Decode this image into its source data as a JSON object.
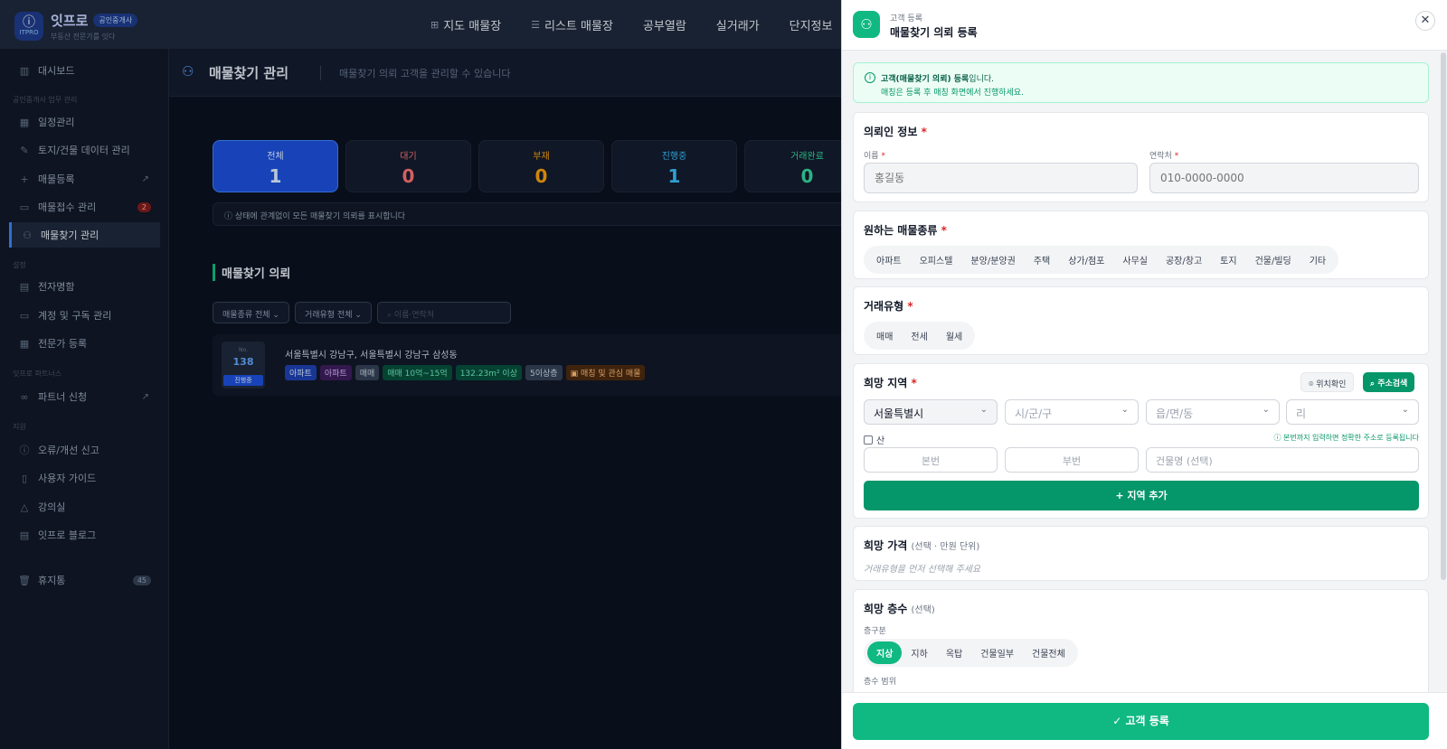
{
  "app": {
    "logo_glyph": "ⓘ",
    "logo_mark": "ITPRO",
    "name": "잇프로",
    "badge": "공인중개사",
    "tagline": "부동산 전문가를 잇다"
  },
  "topnav": {
    "items": [
      {
        "label": "지도 매물장",
        "icon": "map-icon"
      },
      {
        "label": "리스트 매물장",
        "icon": "list-icon"
      },
      {
        "label": "공부열람"
      },
      {
        "label": "실거래가"
      },
      {
        "label": "단지정보"
      }
    ]
  },
  "sidebar": {
    "dashboard": "대시보드",
    "section_work": "공인중개사 업무 관리",
    "schedule": "일정관리",
    "land_data": "토지/건물 데이터 관리",
    "listing_register": "매물등록",
    "listing_intake": "매물접수 관리",
    "listing_intake_count": "2",
    "property_search": "매물찾기 관리",
    "section_settings": "설정",
    "business_card": "전자명함",
    "account": "계정 및 구독 관리",
    "expert_register": "전문가 등록",
    "section_partners": "잇프로 파트너스",
    "partner_apply": "파트너 신청",
    "section_support": "지원",
    "report": "오류/개선 신고",
    "guide": "사용자 가이드",
    "lecture": "강의실",
    "blog": "잇프로 블로그",
    "trash": "휴지통",
    "trash_count": "45"
  },
  "page": {
    "title": "매물찾기 관리",
    "description": "매물찾기 의뢰 고객을 관리할 수 있습니다",
    "stats": [
      {
        "label": "전체",
        "value": "1",
        "color": "#dbeafe"
      },
      {
        "label": "대기",
        "value": "0",
        "color": "#f87171"
      },
      {
        "label": "부재",
        "value": "0",
        "color": "#f59e0b"
      },
      {
        "label": "진행중",
        "value": "1",
        "color": "#38bdf8"
      },
      {
        "label": "거래완료",
        "value": "0",
        "color": "#34d399"
      }
    ],
    "stat_note": "상태에 관계없이 모든 매물찾기 의뢰를 표시합니다",
    "list_title": "매물찾기 의뢰",
    "filter_type": "매물종류 전체",
    "filter_deal": "거래유형 전체",
    "search_placeholder": "이름·연락처",
    "card": {
      "prefix": "No.",
      "number": "138",
      "status": "진행중",
      "address": "서울특별시 강남구, 서울특별시 강남구 삼성동",
      "tags": [
        {
          "text": "아파트",
          "style": "t-blue"
        },
        {
          "text": "아파트",
          "style": "t-purple"
        },
        {
          "text": "매매",
          "style": "t-gray"
        },
        {
          "text": "매매 10억~15억",
          "style": "t-green"
        },
        {
          "text": "132.23m² 이상",
          "style": "t-green"
        },
        {
          "text": "5이상층",
          "style": "t-gray"
        },
        {
          "text": "매칭 및 관심 매물",
          "style": "t-orange"
        }
      ]
    }
  },
  "drawer": {
    "crumb": "고객 등록",
    "title": "매물찾기 의뢰 등록",
    "notice_bold": "고객(매물찾기 의뢰) 등록",
    "notice_rest": "입니다.",
    "notice_line2": "매칭은 등록 후 매칭 화면에서 진행하세요.",
    "requester": {
      "title": "의뢰인 정보",
      "name_label": "이름",
      "name_placeholder": "홍길동",
      "phone_label": "연락처",
      "phone_placeholder": "010-0000-0000"
    },
    "property_types": {
      "title": "원하는 매물종류",
      "options": [
        "아파트",
        "오피스텔",
        "분양/분양권",
        "주택",
        "상가/점포",
        "사무실",
        "공장/창고",
        "토지",
        "건물/빌딩",
        "기타"
      ]
    },
    "deal_types": {
      "title": "거래유형",
      "options": [
        "매매",
        "전세",
        "월세"
      ]
    },
    "region": {
      "title": "희망 지역",
      "locate_button": "위치확인",
      "search_button": "주소검색",
      "sido": "서울특별시",
      "sigungu": "시/군/구",
      "eupmyeondong": "읍/면/동",
      "ri": "리",
      "mountain_label": "산",
      "hint": "본번까지 입력하면 정확한 주소로 등록됩니다",
      "main_no": "본번",
      "sub_no": "부번",
      "building_placeholder": "건물명 (선택)",
      "add_button": "지역 추가"
    },
    "price": {
      "title": "희망 가격",
      "optional": "(선택 · 만원 단위)",
      "hint": "거래유형을 먼저 선택해 주세요"
    },
    "floor": {
      "title": "희망 층수",
      "optional": "(선택)",
      "type_label": "층구분",
      "options": [
        "지상",
        "지하",
        "옥탑",
        "건물일부",
        "건물전체"
      ],
      "selected": "지상",
      "range_label": "층수 범위"
    },
    "submit": "고객 등록"
  }
}
